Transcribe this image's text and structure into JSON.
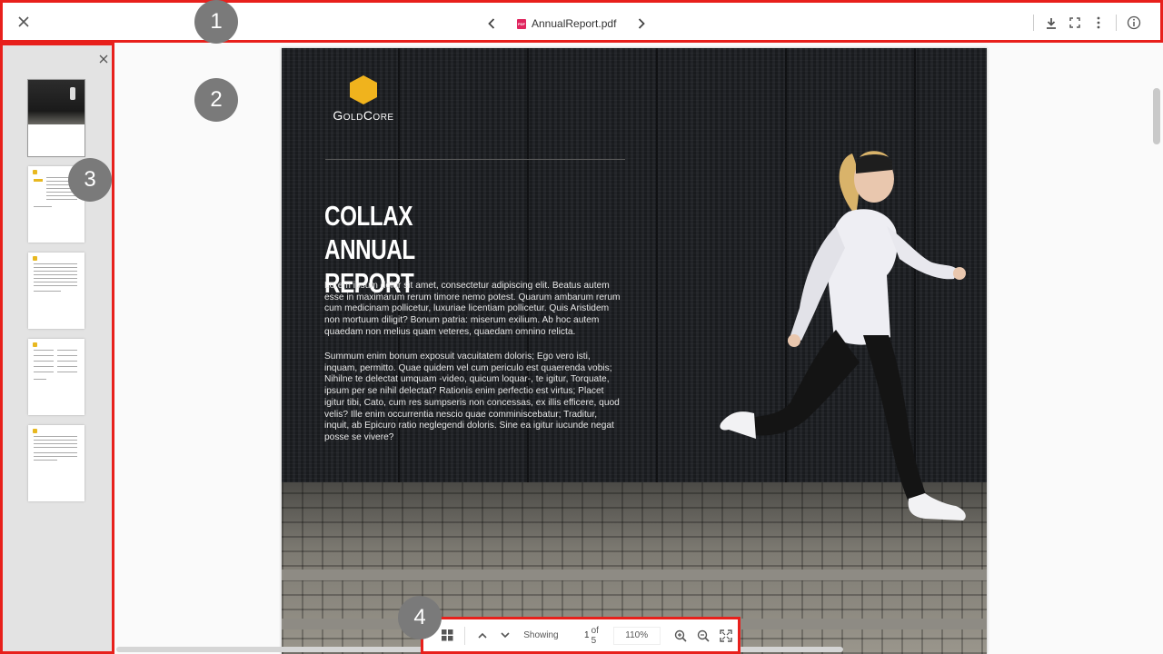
{
  "toolbar": {
    "file_name": "AnnualReport.pdf",
    "file_type_badge": "PDF",
    "icons": [
      "close-icon",
      "chevron-left-icon",
      "chevron-right-icon",
      "download-icon",
      "fullscreen-icon",
      "more-vertical-icon",
      "info-icon"
    ]
  },
  "sidebar": {
    "thumbnail_count": 5,
    "active_page": 1
  },
  "document": {
    "brand_name": "GoldCore",
    "title_line1": "COLLAX ANNUAL",
    "title_line2": "REPORT",
    "paragraph1": "Lorem ipsum dolor sit amet, consectetur adipiscing elit. Beatus autem esse in maximarum rerum timore nemo potest. Quarum ambarum rerum cum medicinam pollicetur, luxuriae licentiam pollicetur. Quis Aristidem non mortuum diligit? Bonum patria: miserum exilium. Ab hoc autem quaedam non melius quam veteres, quaedam omnino relicta.",
    "paragraph2": "Summum enim bonum exposuit vacuitatem doloris; Ego vero isti, inquam, permitto. Quae quidem vel cum periculo est quaerenda vobis; Nihilne te delectat umquam -video, quicum loquar-, te igitur, Torquate, ipsum per se nihil delectat? Rationis enim perfectio est virtus; Placet igitur tibi, Cato, cum res sumpseris non concessas, ex illis efficere, quod velis? Ille enim occurrentia nescio quae comminiscebatur; Traditur, inquit, ab Epicuro ratio neglegendi doloris. Sine ea igitur iucunde negat posse se vivere?"
  },
  "bottom_toolbar": {
    "showing_label": "Showing",
    "current_page": "1",
    "of_label": "of 5",
    "zoom": "110%"
  },
  "callouts": [
    "1",
    "2",
    "3",
    "4"
  ],
  "colors": {
    "highlight": "#e8201c",
    "brand_gold": "#f0b31d",
    "callout_gray": "#7a7a7a"
  }
}
